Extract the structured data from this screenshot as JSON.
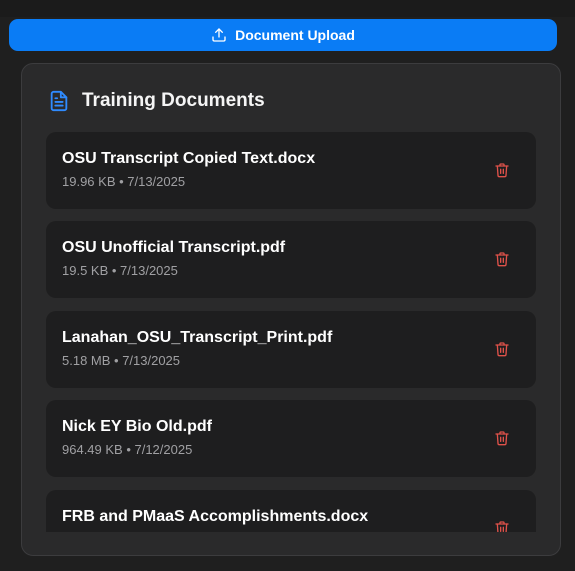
{
  "upload": {
    "label": "Document Upload",
    "icon": "upload-icon",
    "color": "#0a7cf5"
  },
  "panel": {
    "title": "Training Documents",
    "icon": "document-icon",
    "accent": "#2f8bff"
  },
  "documents": [
    {
      "name": "OSU Transcript Copied Text.docx",
      "meta": "19.96 KB • 7/13/2025"
    },
    {
      "name": "OSU Unofficial Transcript.pdf",
      "meta": "19.5 KB • 7/13/2025"
    },
    {
      "name": "Lanahan_OSU_Transcript_Print.pdf",
      "meta": "5.18 MB • 7/13/2025"
    },
    {
      "name": "Nick EY Bio Old.pdf",
      "meta": "964.49 KB • 7/12/2025"
    },
    {
      "name": "FRB and PMaaS Accomplishments.docx",
      "meta": ""
    }
  ],
  "delete_icon": "trash-icon",
  "delete_color": "#e0524a"
}
